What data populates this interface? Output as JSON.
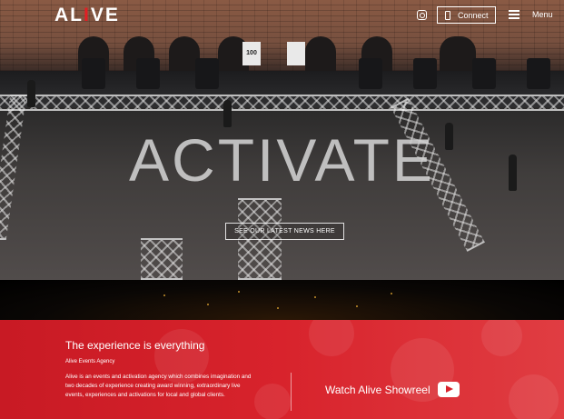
{
  "header": {
    "logo_prefix": "AL",
    "logo_accent": "I",
    "logo_suffix": "VE",
    "connect_label": "Connect",
    "menu_label": "Menu",
    "icons": [
      "instagram-icon",
      "phone-icon",
      "hamburger-icon"
    ]
  },
  "hero": {
    "title": "ACTIVATE",
    "news_button": "SEE OUR LATEST NEWS HERE",
    "sign_label": "100"
  },
  "intro": {
    "tagline": "The experience is everything",
    "agency": "Alive Events Agency",
    "description": "Alive is an events and activation agency which combines imagination and two decades of experience creating award winning, extraordinary live events, experiences and activations for local and global clients.",
    "showreel_label": "Watch Alive Showreel"
  },
  "colors": {
    "brand_red": "#d8232c",
    "logo_accent": "#e31e24"
  }
}
